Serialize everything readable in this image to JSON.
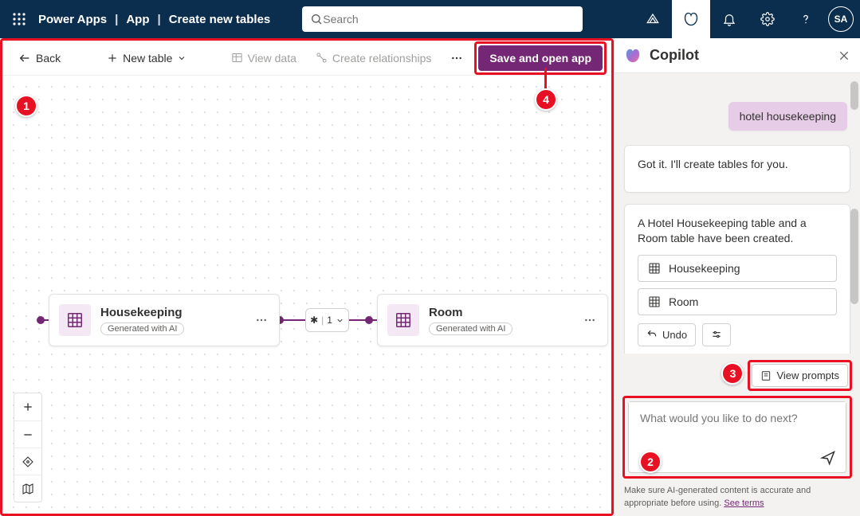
{
  "header": {
    "app": "Power Apps",
    "crumb1": "App",
    "crumb2": "Create new tables",
    "search_placeholder": "Search",
    "avatar": "SA"
  },
  "toolbar": {
    "back": "Back",
    "new_table": "New table",
    "view_data": "View data",
    "create_rel": "Create relationships",
    "save_open": "Save and open app"
  },
  "canvas": {
    "table1": {
      "title": "Housekeeping",
      "ai": "Generated with AI"
    },
    "table2": {
      "title": "Room",
      "ai": "Generated with AI"
    },
    "rel_text": "1"
  },
  "copilot": {
    "title": "Copilot",
    "user_msg": "hotel housekeeping",
    "bot_msg1": "Got it. I'll create tables for you.",
    "bot_msg2": "A Hotel Housekeeping table and a Room table have been created.",
    "chip1": "Housekeeping",
    "chip2": "Room",
    "undo": "Undo",
    "view_prompts": "View prompts",
    "placeholder": "What would you like to do next?",
    "disclaimer_pre": "Make sure AI-generated content is accurate and appropriate before using. ",
    "disclaimer_link": "See terms"
  },
  "callouts": {
    "c1": "1",
    "c2": "2",
    "c3": "3",
    "c4": "4"
  }
}
